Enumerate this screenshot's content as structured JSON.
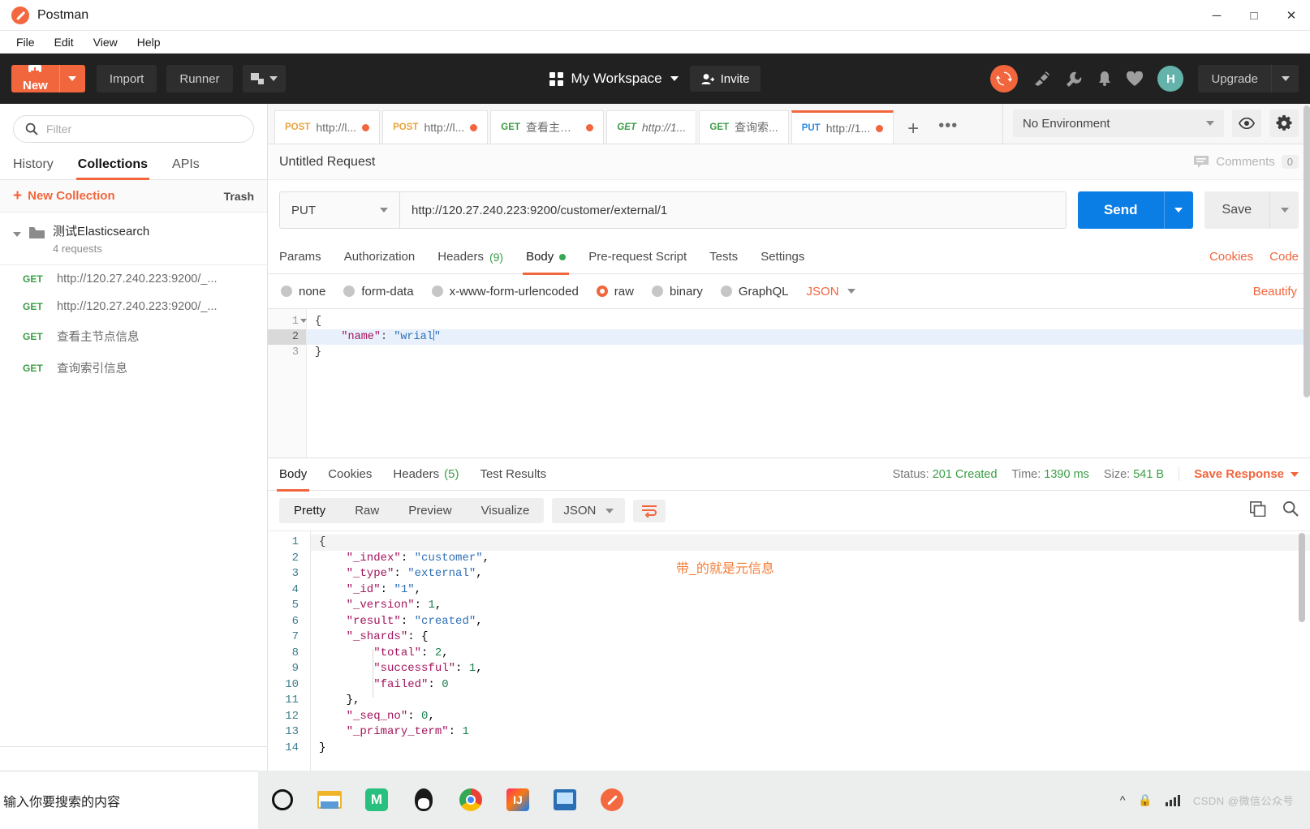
{
  "window": {
    "title": "Postman",
    "logo_icon": "postman-logo-icon",
    "minimize": "─",
    "maximize": "□",
    "close": "✕"
  },
  "menubar": {
    "items": [
      "File",
      "Edit",
      "View",
      "Help"
    ]
  },
  "header": {
    "new_label": "New",
    "import_label": "Import",
    "runner_label": "Runner",
    "workspace_label": "My Workspace",
    "invite_label": "Invite",
    "upgrade_label": "Upgrade",
    "avatar_initial": "H",
    "icons": [
      "sync-icon",
      "satellite-icon",
      "wrench-icon",
      "bell-icon",
      "heart-icon"
    ]
  },
  "sidebar": {
    "filter_placeholder": "Filter",
    "filter_value": "",
    "tabs": [
      {
        "label": "History",
        "active": false
      },
      {
        "label": "Collections",
        "active": true
      },
      {
        "label": "APIs",
        "active": false
      }
    ],
    "new_collection_label": "New Collection",
    "trash_label": "Trash",
    "collection": {
      "name": "测试Elasticsearch",
      "count": "4 requests"
    },
    "requests": [
      {
        "method": "GET",
        "name": "http://120.27.240.223:9200/_..."
      },
      {
        "method": "GET",
        "name": "http://120.27.240.223:9200/_..."
      },
      {
        "method": "GET",
        "name": "查看主节点信息"
      },
      {
        "method": "GET",
        "name": "查询索引信息"
      }
    ]
  },
  "tabs": {
    "items": [
      {
        "method": "POST",
        "title": "http://l...",
        "unsaved": true,
        "active": false,
        "italic": false
      },
      {
        "method": "POST",
        "title": "http://l...",
        "unsaved": true,
        "active": false,
        "italic": false
      },
      {
        "method": "GET",
        "title": "查看主节...",
        "unsaved": true,
        "active": false,
        "italic": false
      },
      {
        "method": "GET",
        "title": "http://1...",
        "unsaved": false,
        "active": false,
        "italic": true
      },
      {
        "method": "GET",
        "title": "查询索...",
        "unsaved": false,
        "active": false,
        "italic": false
      },
      {
        "method": "PUT",
        "title": "http://1...",
        "unsaved": true,
        "active": true,
        "italic": false
      }
    ],
    "add_label": "+",
    "more_label": "•••"
  },
  "environment": {
    "selected": "No Environment",
    "eye_icon": "eye-icon",
    "gear_icon": "gear-icon"
  },
  "request": {
    "title": "Untitled Request",
    "comments_label": "Comments",
    "comments_count": "0",
    "method": "PUT",
    "url": "http://120.27.240.223:9200/customer/external/1",
    "send_label": "Send",
    "save_label": "Save",
    "tabs": [
      {
        "label": "Params",
        "badge": "",
        "dot": false,
        "active": false
      },
      {
        "label": "Authorization",
        "badge": "",
        "dot": false,
        "active": false
      },
      {
        "label": "Headers",
        "badge": "(9)",
        "dot": false,
        "active": false
      },
      {
        "label": "Body",
        "badge": "",
        "dot": true,
        "active": true
      },
      {
        "label": "Pre-request Script",
        "badge": "",
        "dot": false,
        "active": false
      },
      {
        "label": "Tests",
        "badge": "",
        "dot": false,
        "active": false
      },
      {
        "label": "Settings",
        "badge": "",
        "dot": false,
        "active": false
      }
    ],
    "cookies_link": "Cookies",
    "code_link": "Code",
    "body_modes": [
      {
        "label": "none",
        "selected": false
      },
      {
        "label": "form-data",
        "selected": false
      },
      {
        "label": "x-www-form-urlencoded",
        "selected": false
      },
      {
        "label": "raw",
        "selected": true
      },
      {
        "label": "binary",
        "selected": false
      },
      {
        "label": "GraphQL",
        "selected": false
      }
    ],
    "raw_format": "JSON",
    "beautify_label": "Beautify",
    "body_lines": [
      {
        "n": "1",
        "fold": true,
        "current": false,
        "text": "{"
      },
      {
        "n": "2",
        "fold": false,
        "current": true,
        "text": "    \"name\": \"wrial\""
      },
      {
        "n": "3",
        "fold": false,
        "current": false,
        "text": "}"
      }
    ]
  },
  "response": {
    "tabs": [
      {
        "label": "Body",
        "badge": "",
        "active": true
      },
      {
        "label": "Cookies",
        "badge": "",
        "active": false
      },
      {
        "label": "Headers",
        "badge": "(5)",
        "active": false
      },
      {
        "label": "Test Results",
        "badge": "",
        "active": false
      }
    ],
    "status_label": "Status:",
    "status_value": "201 Created",
    "time_label": "Time:",
    "time_value": "1390 ms",
    "size_label": "Size:",
    "size_value": "541 B",
    "save_response_label": "Save Response",
    "view_modes": [
      {
        "label": "Pretty",
        "active": true
      },
      {
        "label": "Raw",
        "active": false
      },
      {
        "label": "Preview",
        "active": false
      },
      {
        "label": "Visualize",
        "active": false
      }
    ],
    "format": "JSON",
    "wrap_icon": "word-wrap-icon",
    "copy_icon": "copy-icon",
    "search_icon": "search-icon",
    "annotation": "带_的就是元信息",
    "lines": [
      {
        "n": "1",
        "text": "{"
      },
      {
        "n": "2",
        "text": "    \"_index\": \"customer\","
      },
      {
        "n": "3",
        "text": "    \"_type\": \"external\","
      },
      {
        "n": "4",
        "text": "    \"_id\": \"1\","
      },
      {
        "n": "5",
        "text": "    \"_version\": 1,"
      },
      {
        "n": "6",
        "text": "    \"result\": \"created\","
      },
      {
        "n": "7",
        "text": "    \"_shards\": {"
      },
      {
        "n": "8",
        "text": "        \"total\": 2,"
      },
      {
        "n": "9",
        "text": "        \"successful\": 1,"
      },
      {
        "n": "10",
        "text": "        \"failed\": 0"
      },
      {
        "n": "11",
        "text": "    },"
      },
      {
        "n": "12",
        "text": "    \"_seq_no\": 0,"
      },
      {
        "n": "13",
        "text": "    \"_primary_term\": 1"
      },
      {
        "n": "14",
        "text": "}"
      }
    ]
  },
  "taskbar": {
    "search_text": "输入你要搜索的内容",
    "apps": [
      "cortana-icon",
      "file-explorer-icon",
      "xmind-icon",
      "qq-icon",
      "chrome-icon",
      "intellij-idea-icon",
      "remote-desktop-icon",
      "postman-icon"
    ],
    "tray": [
      "chevron-up-icon",
      "security-icon",
      "network-icon",
      "volume-icon"
    ],
    "watermark": "CSDN @微信公众号"
  },
  "colors": {
    "accent": "#f1663d",
    "send_blue": "#0b7ee6",
    "get_green": "#3a9e45",
    "post_yellow": "#e9a33d",
    "put_blue": "#2f8ae2",
    "header_dark": "#212121"
  }
}
